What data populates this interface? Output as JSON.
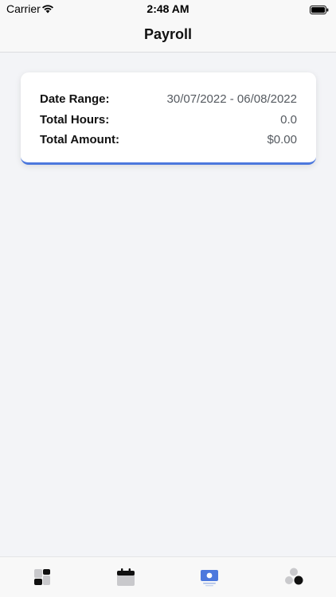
{
  "status_bar": {
    "carrier": "Carrier",
    "time": "2:48 AM"
  },
  "nav": {
    "title": "Payroll"
  },
  "summary": {
    "date_range_label": "Date Range:",
    "date_range_value": "30/07/2022 - 06/08/2022",
    "total_hours_label": "Total Hours:",
    "total_hours_value": "0.0",
    "total_amount_label": "Total Amount:",
    "total_amount_value": "$0.00"
  },
  "tab_bar": {
    "tabs": [
      {
        "icon": "dashboard-icon",
        "selected": false
      },
      {
        "icon": "calendar-icon",
        "selected": false
      },
      {
        "icon": "payroll-icon",
        "selected": true
      },
      {
        "icon": "team-icon",
        "selected": false
      }
    ]
  },
  "colors": {
    "accent": "#4c78dd",
    "background": "#f3f4f7",
    "card": "#ffffff",
    "inactive_icon": "#c9c9cc"
  }
}
